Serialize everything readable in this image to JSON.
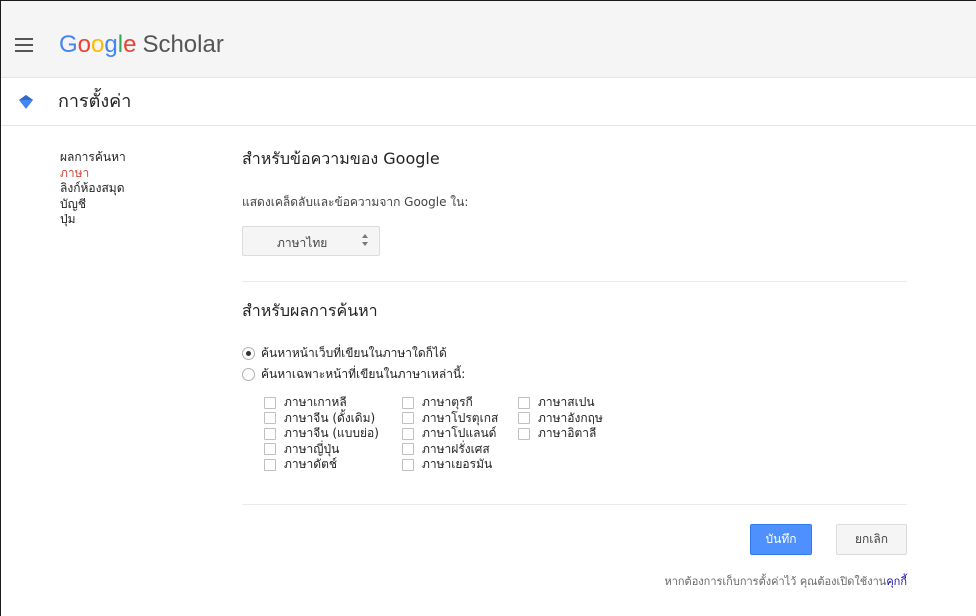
{
  "header": {
    "logo_google": [
      "G",
      "o",
      "o",
      "g",
      "l",
      "e"
    ],
    "logo_colors": [
      "#4285f4",
      "#ea4335",
      "#fbbc05",
      "#4285f4",
      "#34a853",
      "#ea4335"
    ],
    "logo_scholar": "Scholar",
    "menu_icon": "hamburger-icon"
  },
  "titlebar": {
    "icon": "settings-gem-icon",
    "icon_color": "#4285f4",
    "title": "การตั้งค่า"
  },
  "sidenav": {
    "items": [
      {
        "label": "ผลการค้นหา",
        "active": false
      },
      {
        "label": "ภาษา",
        "active": true
      },
      {
        "label": "ลิงก์ห้องสมุด",
        "active": false
      },
      {
        "label": "บัญชี",
        "active": false
      },
      {
        "label": "ปุ่ม",
        "active": false
      }
    ],
    "active_color": "#d14836"
  },
  "interface": {
    "title": "สำหรับข้อความของ Google",
    "desc": "แสดงเคล็ดลับและข้อความจาก Google ใน:",
    "select_value": "ภาษาไทย"
  },
  "search": {
    "title": "สำหรับผลการค้นหา",
    "radio_any": "ค้นหาหน้าเว็บที่เขียนในภาษาใดก็ได้",
    "radio_only": "ค้นหาเฉพาะหน้าที่เขียนในภาษาเหล่านี้:",
    "selected": "any",
    "languages": [
      [
        "ภาษาเกาหลี",
        "ภาษาจีน (ดั้งเดิม)",
        "ภาษาจีน (แบบย่อ)",
        "ภาษาญี่ปุ่น",
        "ภาษาดัตช์"
      ],
      [
        "ภาษาตุรกี",
        "ภาษาโปรตุเกส",
        "ภาษาโปแลนด์",
        "ภาษาฝรั่งเศส",
        "ภาษาเยอรมัน"
      ],
      [
        "ภาษาสเปน",
        "ภาษาอังกฤษ",
        "ภาษาอิตาลี"
      ]
    ]
  },
  "actions": {
    "save": "บันทึก",
    "cancel": "ยกเลิก",
    "save_color": "#4d90fe"
  },
  "footer": {
    "note": "หากต้องการเก็บการตั้งค่าไว้ คุณต้องเปิดใช้งาน",
    "link": "คุกกี้"
  }
}
